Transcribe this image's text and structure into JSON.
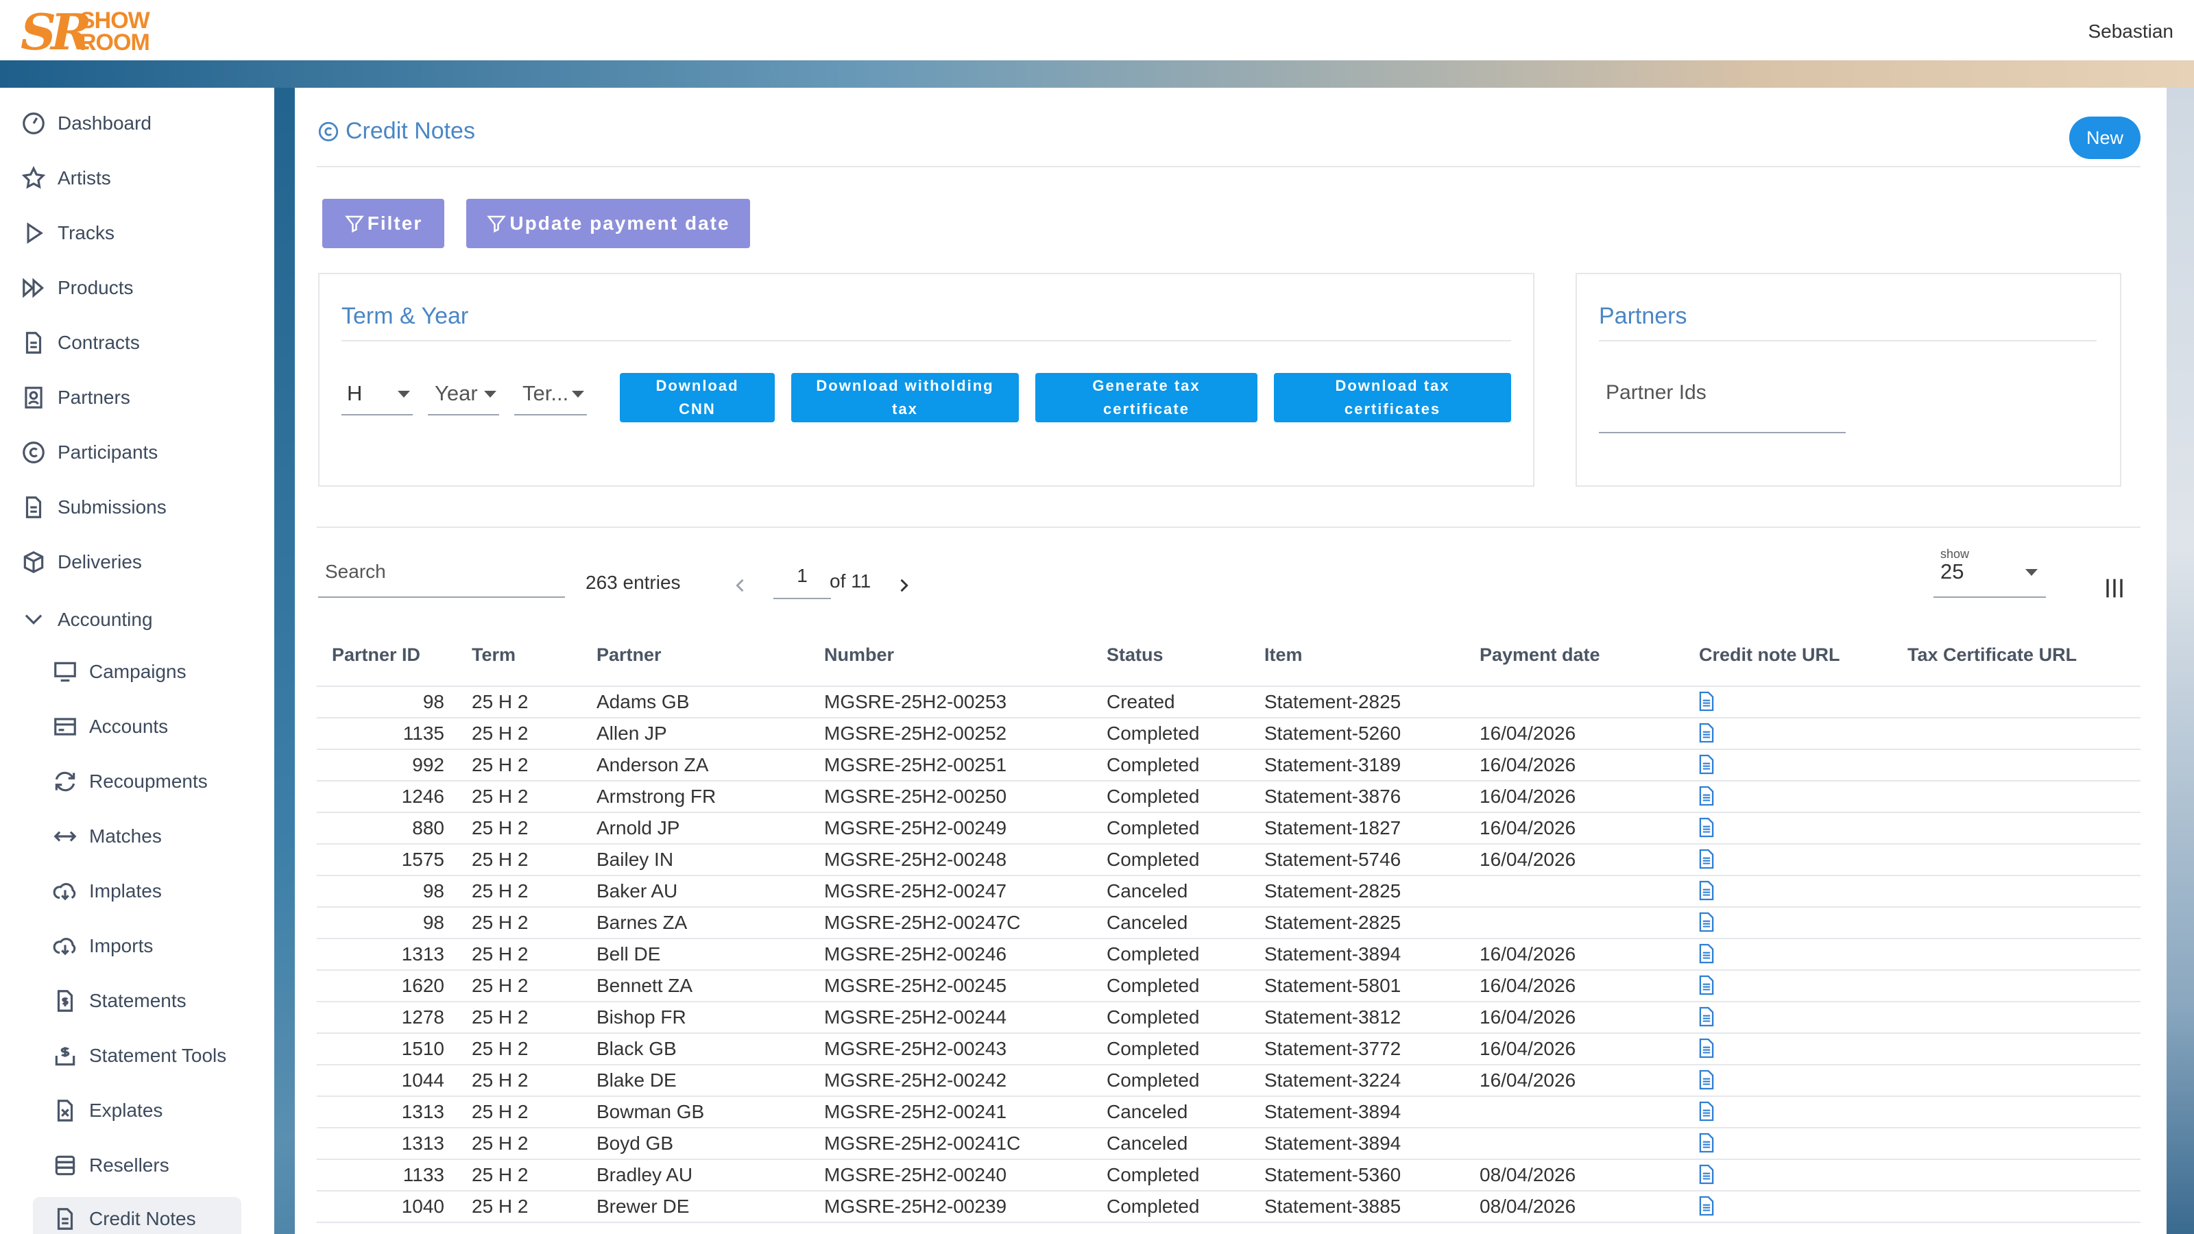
{
  "brand": {
    "logo_letters": "SR",
    "logo_word1": "SHOW",
    "logo_word2": "ROOM",
    "accent": "#f08b2a"
  },
  "header": {
    "user": "Sebastian"
  },
  "sidebar": {
    "items": [
      {
        "label": "Dashboard",
        "icon": "dashboard-icon"
      },
      {
        "label": "Artists",
        "icon": "star-icon"
      },
      {
        "label": "Tracks",
        "icon": "play-icon"
      },
      {
        "label": "Products",
        "icon": "fast-forward-icon"
      },
      {
        "label": "Contracts",
        "icon": "document-icon"
      },
      {
        "label": "Partners",
        "icon": "user-card-icon"
      },
      {
        "label": "Participants",
        "icon": "copyright-icon"
      },
      {
        "label": "Submissions",
        "icon": "document-icon"
      },
      {
        "label": "Deliveries",
        "icon": "box-icon"
      },
      {
        "label": "Accounting",
        "icon": "chevron-down-icon"
      }
    ],
    "sub_items": [
      {
        "label": "Campaigns",
        "icon": "monitor-icon"
      },
      {
        "label": "Accounts",
        "icon": "card-icon"
      },
      {
        "label": "Recoupments",
        "icon": "refresh-icon"
      },
      {
        "label": "Matches",
        "icon": "arrows-icon"
      },
      {
        "label": "Implates",
        "icon": "download-cloud-icon"
      },
      {
        "label": "Imports",
        "icon": "download-cloud-icon"
      },
      {
        "label": "Statements",
        "icon": "dollar-doc-icon"
      },
      {
        "label": "Statement Tools",
        "icon": "dollar-box-icon"
      },
      {
        "label": "Explates",
        "icon": "excel-doc-icon"
      },
      {
        "label": "Resellers",
        "icon": "database-icon"
      },
      {
        "label": "Credit Notes",
        "icon": "document-icon",
        "active": true
      }
    ]
  },
  "page": {
    "title": "Credit Notes",
    "new_label": "New"
  },
  "toolbar": {
    "filter_label": "Filter",
    "update_payment_label": "Update payment date"
  },
  "term_year": {
    "title": "Term & Year",
    "term_value": "H",
    "year_placeholder": "Year",
    "ter_placeholder": "Ter...",
    "buttons": {
      "download_cnn_1": "Download",
      "download_cnn_2": "CNN",
      "download_withholding_1": "Download witholding",
      "download_withholding_2": "tax",
      "generate_tax_1": "Generate tax",
      "generate_tax_2": "certificate",
      "download_tax_1": "Download tax",
      "download_tax_2": "certificates"
    }
  },
  "partners": {
    "title": "Partners",
    "placeholder": "Partner Ids"
  },
  "list": {
    "search_placeholder": "Search",
    "entries": "263 entries",
    "page": "1",
    "of": "of 11",
    "show_label": "show",
    "show_value": "25"
  },
  "columns": [
    "Partner ID",
    "Term",
    "Partner",
    "Number",
    "Status",
    "Item",
    "Payment date",
    "Credit note URL",
    "Tax Certificate URL"
  ],
  "rows": [
    [
      "98",
      "25 H 2",
      "Adams GB",
      "MGSRE-25H2-00253",
      "Created",
      "Statement-2825",
      ""
    ],
    [
      "1135",
      "25 H 2",
      "Allen JP",
      "MGSRE-25H2-00252",
      "Completed",
      "Statement-5260",
      "16/04/2026"
    ],
    [
      "992",
      "25 H 2",
      "Anderson ZA",
      "MGSRE-25H2-00251",
      "Completed",
      "Statement-3189",
      "16/04/2026"
    ],
    [
      "1246",
      "25 H 2",
      "Armstrong FR",
      "MGSRE-25H2-00250",
      "Completed",
      "Statement-3876",
      "16/04/2026"
    ],
    [
      "880",
      "25 H 2",
      "Arnold JP",
      "MGSRE-25H2-00249",
      "Completed",
      "Statement-1827",
      "16/04/2026"
    ],
    [
      "1575",
      "25 H 2",
      "Bailey IN",
      "MGSRE-25H2-00248",
      "Completed",
      "Statement-5746",
      "16/04/2026"
    ],
    [
      "98",
      "25 H 2",
      "Baker AU",
      "MGSRE-25H2-00247",
      "Canceled",
      "Statement-2825",
      ""
    ],
    [
      "98",
      "25 H 2",
      "Barnes ZA",
      "MGSRE-25H2-00247C",
      "Canceled",
      "Statement-2825",
      ""
    ],
    [
      "1313",
      "25 H 2",
      "Bell DE",
      "MGSRE-25H2-00246",
      "Completed",
      "Statement-3894",
      "16/04/2026"
    ],
    [
      "1620",
      "25 H 2",
      "Bennett ZA",
      "MGSRE-25H2-00245",
      "Completed",
      "Statement-5801",
      "16/04/2026"
    ],
    [
      "1278",
      "25 H 2",
      "Bishop FR",
      "MGSRE-25H2-00244",
      "Completed",
      "Statement-3812",
      "16/04/2026"
    ],
    [
      "1510",
      "25 H 2",
      "Black GB",
      "MGSRE-25H2-00243",
      "Completed",
      "Statement-3772",
      "16/04/2026"
    ],
    [
      "1044",
      "25 H 2",
      "Blake DE",
      "MGSRE-25H2-00242",
      "Completed",
      "Statement-3224",
      "16/04/2026"
    ],
    [
      "1313",
      "25 H 2",
      "Bowman GB",
      "MGSRE-25H2-00241",
      "Canceled",
      "Statement-3894",
      ""
    ],
    [
      "1313",
      "25 H 2",
      "Boyd GB",
      "MGSRE-25H2-00241C",
      "Canceled",
      "Statement-3894",
      ""
    ],
    [
      "1133",
      "25 H 2",
      "Bradley AU",
      "MGSRE-25H2-00240",
      "Completed",
      "Statement-5360",
      "08/04/2026"
    ],
    [
      "1040",
      "25 H 2",
      "Brewer DE",
      "MGSRE-25H2-00239",
      "Completed",
      "Statement-3885",
      "08/04/2026"
    ]
  ]
}
